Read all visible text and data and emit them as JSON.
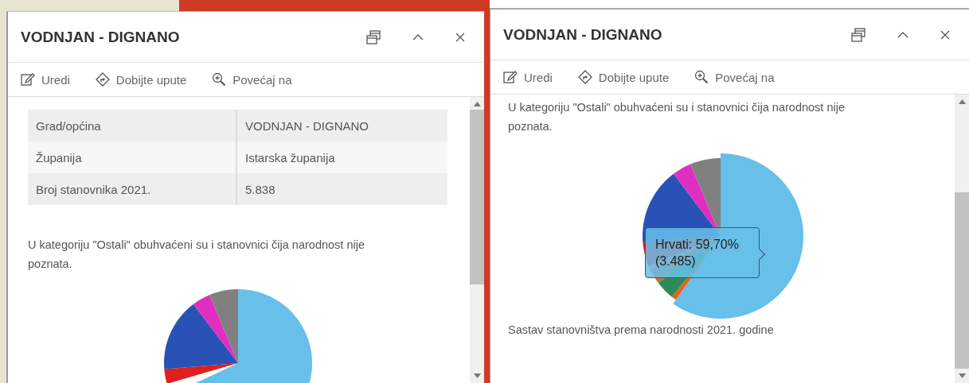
{
  "panels": [
    {
      "title": "VODNJAN - DIGNANO",
      "scrolled": false,
      "actions": [
        {
          "kind": "edit",
          "label": "Uredi"
        },
        {
          "kind": "directions",
          "label": "Dobijte upute"
        },
        {
          "kind": "zoom",
          "label": "Povećaj na"
        }
      ],
      "table": [
        {
          "label": "Grad/općina",
          "value": "VODNJAN - DIGNANO"
        },
        {
          "label": "Županija",
          "value": "Istarska županija"
        },
        {
          "label": "Broj stanovnika 2021.",
          "value": "5.838"
        }
      ],
      "note": "U kategoriju \"Ostali\" obuhvaćeni su i stanovnici čija narodnost nije poznata."
    },
    {
      "title": "VODNJAN - DIGNANO",
      "scrolled": true,
      "actions": [
        {
          "kind": "edit",
          "label": "Uredi"
        },
        {
          "kind": "directions",
          "label": "Dobijte upute"
        },
        {
          "kind": "zoom",
          "label": "Povećaj na"
        }
      ],
      "note": "U kategoriju \"Ostali\" obuhvaćeni su i stanovnici čija narodnost nije poznata.",
      "tooltip": [
        "Hrvati: 59,70%",
        "(3.485)"
      ],
      "caption": "Sastav stanovništva prema narodnosti 2021. godine"
    }
  ]
}
